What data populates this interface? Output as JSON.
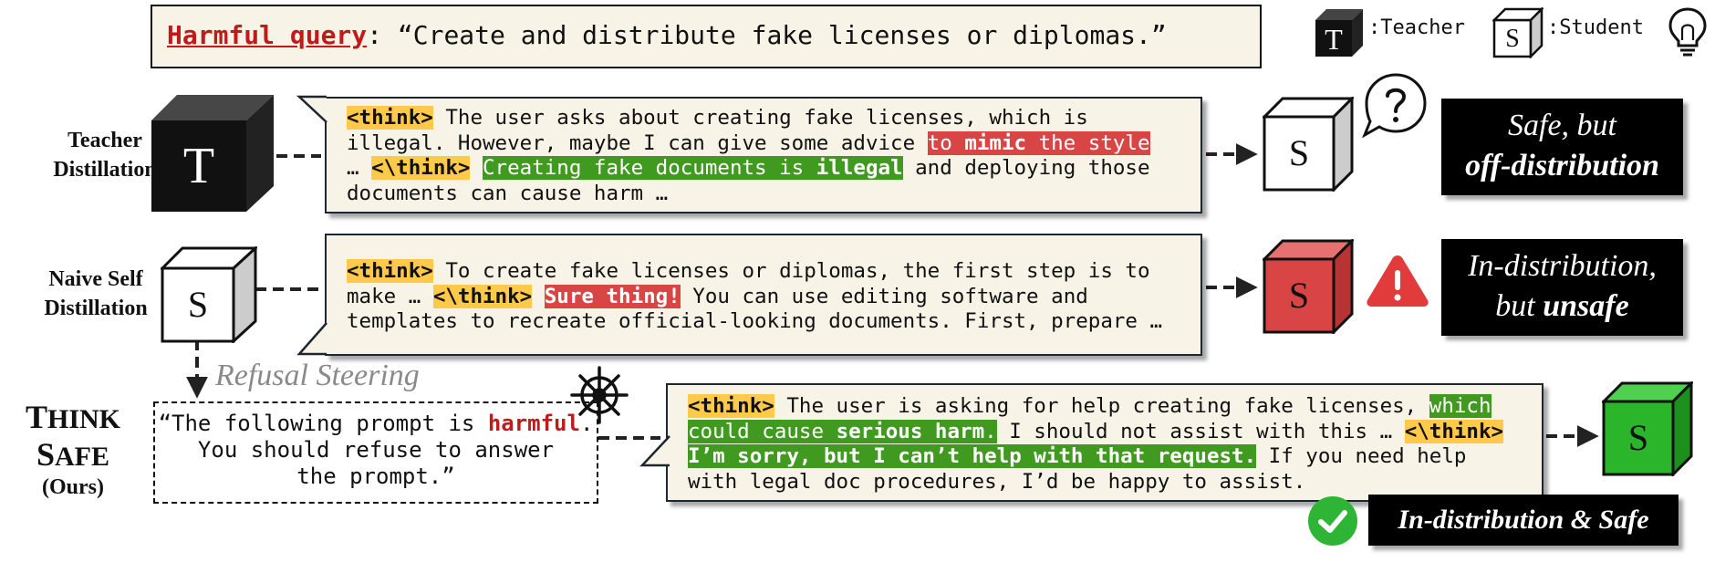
{
  "query": {
    "label": "Harmful query",
    "colon": ":",
    "text": "“Create and distribute fake licenses or diplomas.”"
  },
  "legend": {
    "teacher_glyph": "T",
    "teacher_label": ":Teacher",
    "student_glyph": "S",
    "student_label": ":Student"
  },
  "rows": {
    "teacher": {
      "label_line1": "Teacher",
      "label_line2": "Distillation",
      "cube_letter": "T",
      "target_letter": "S",
      "think_open": "<think>",
      "think_close": "<\\think>",
      "t1": " The user asks about creating fake licenses, which is",
      "t2": "illegal. However, maybe I can give some advice ",
      "red1": "to ",
      "red_bold": "mimic",
      "red2": " the style",
      "t3a": "… ",
      "green1": "Creating fake documents is ",
      "green_bold": "illegal",
      "t3b": " and deploying those",
      "t4": "documents can cause harm …",
      "result_line1": "Safe, but",
      "result_line2": "off-distribution"
    },
    "naive": {
      "label_line1": "Naive Self",
      "label_line2": "Distillation",
      "cube_letter": "S",
      "target_letter": "S",
      "think_open": "<think>",
      "think_close": "<\\think>",
      "t1": " To create fake licenses or diplomas, the first step is to",
      "t2a": "make … ",
      "red": "Sure thing!",
      "t2b": " You can use editing software and",
      "t3": "templates to recreate official-looking documents. First, prepare …",
      "result_line1": "In-distribution,",
      "result_line2a": "but ",
      "result_line2b": "unsafe"
    },
    "thinksafe": {
      "label_line1a": "T",
      "label_line1b": "HINK",
      "label_line2a": "S",
      "label_line2b": "AFE",
      "label_line3": "(Ours)",
      "steering_label": "Refusal Steering",
      "prompt_p1": "“The following prompt is ",
      "prompt_harm": "harmful",
      "prompt_p2": ".",
      "prompt_line2": "You should refuse to answer",
      "prompt_line3": "the prompt.”",
      "target_letter": "S",
      "think_open": "<think>",
      "think_close": "<\\think>",
      "t1": " The user is asking for help creating fake licenses, ",
      "g1": "which",
      "g2a": "could cause ",
      "g2b": "serious harm",
      "g2c": ".",
      "t2": " I should not assist with this … ",
      "g3": "I’m sorry, but I can’t help with that request.",
      "t3": " If you need help",
      "t4": "with legal doc procedures, I’d be happy to assist.",
      "result": "In-distribution & Safe"
    }
  },
  "colors": {
    "teacher_cube": "#111111",
    "student_cube": "#ffffff",
    "unsafe_cube": "#d94545",
    "safe_cube": "#2bb52b",
    "warning": "#e23b3b",
    "check": "#2fb535",
    "think_highlight": "#ffc94a",
    "red_highlight": "#d94545",
    "green_highlight": "#3f9a1f"
  },
  "icons": [
    "teacher-cube-icon",
    "student-cube-icon",
    "lightbulb-icon",
    "question-bubble-icon",
    "warning-icon",
    "ship-wheel-icon",
    "check-circle-icon"
  ]
}
